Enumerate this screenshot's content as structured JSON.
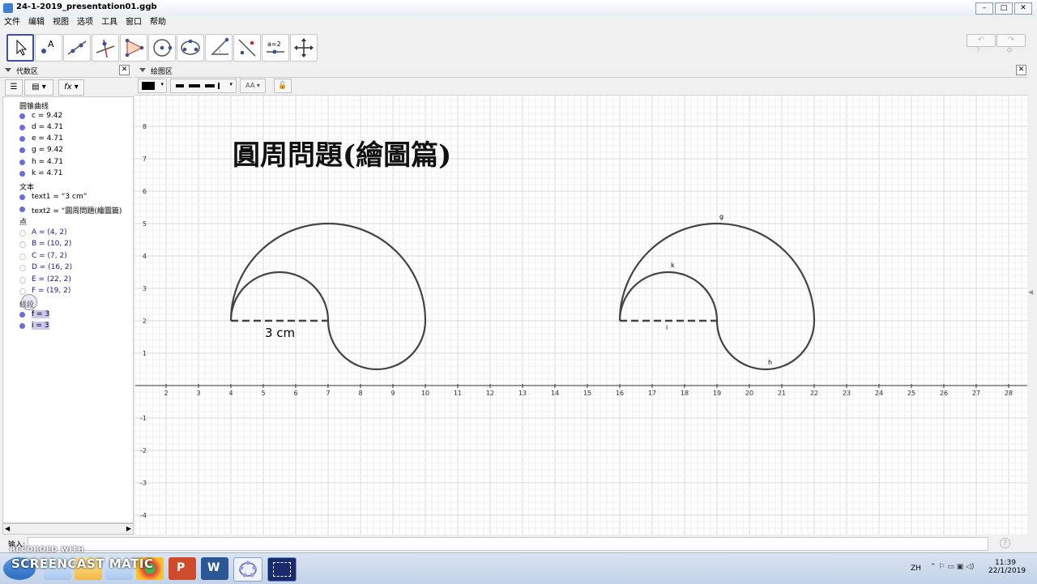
{
  "window": {
    "title": "24-1-2019_presentation01.ggb"
  },
  "menu": [
    "文件",
    "编辑",
    "视图",
    "选项",
    "工具",
    "窗口",
    "帮助"
  ],
  "toolbar_tools": [
    "move-tool-icon",
    "point-tool-icon",
    "line-tool-icon",
    "perpendicular-tool-icon",
    "polygon-tool-icon",
    "circle-tool-icon",
    "conic-tool-icon",
    "angle-tool-icon",
    "reflect-tool-icon",
    "slider-tool-icon",
    "move-view-tool-icon"
  ],
  "slider_tool_label": "a=2",
  "algebra": {
    "title": "代数区",
    "fx_label": "fx",
    "groups": [
      {
        "name": "圆锥曲线",
        "items": [
          {
            "text": "c = 9.42",
            "visible": true
          },
          {
            "text": "d = 4.71",
            "visible": true
          },
          {
            "text": "e = 4.71",
            "visible": true
          },
          {
            "text": "g = 9.42",
            "visible": true
          },
          {
            "text": "h = 4.71",
            "visible": true
          },
          {
            "text": "k = 4.71",
            "visible": true
          }
        ]
      },
      {
        "name": "文本",
        "items": [
          {
            "text": "text1 = “3 cm”",
            "visible": true
          },
          {
            "text": "text2 = “圓周問題(繪圖篇)",
            "visible": true
          }
        ]
      },
      {
        "name": "点",
        "items": [
          {
            "text": "A = (4, 2)",
            "visible": false
          },
          {
            "text": "B = (10, 2)",
            "visible": false
          },
          {
            "text": "C = (7, 2)",
            "visible": false
          },
          {
            "text": "D = (16, 2)",
            "visible": false
          },
          {
            "text": "E = (22, 2)",
            "visible": false
          },
          {
            "text": "F = (19, 2)",
            "visible": false
          }
        ]
      },
      {
        "name": "线段",
        "items": [
          {
            "text": "f = 3",
            "visible": true,
            "selected": true
          },
          {
            "text": "i = 3",
            "visible": true,
            "selected": true
          }
        ]
      }
    ]
  },
  "graphics": {
    "title": "绘图区",
    "heading": "圓周問題(繪圖篇)",
    "left_label": "3 cm",
    "object_labels": {
      "g": "g",
      "k": "k",
      "h": "h",
      "i": "i"
    },
    "x_ticks": [
      "2",
      "3",
      "4",
      "5",
      "6",
      "7",
      "8",
      "9",
      "10",
      "11",
      "12",
      "13",
      "14",
      "15",
      "16",
      "17",
      "18",
      "19",
      "20",
      "21",
      "22",
      "23",
      "24",
      "25",
      "26",
      "27",
      "28"
    ],
    "y_ticks_pos": [
      "1",
      "2",
      "3",
      "4",
      "5",
      "6",
      "7",
      "8"
    ],
    "y_ticks_neg": [
      "-1",
      "-2",
      "-3",
      "-4"
    ]
  },
  "input": {
    "label": "输入:",
    "help": "?"
  },
  "taskbar": {
    "time": "11:39",
    "date": "22/1/2019",
    "lang": "ZH",
    "watermark_small": "RECORDED WITH",
    "watermark_big": "SCREENCAST MATIC"
  },
  "colors": {
    "accent": "#3c50a0",
    "object": "#6b6be0",
    "curve": "#444444"
  }
}
